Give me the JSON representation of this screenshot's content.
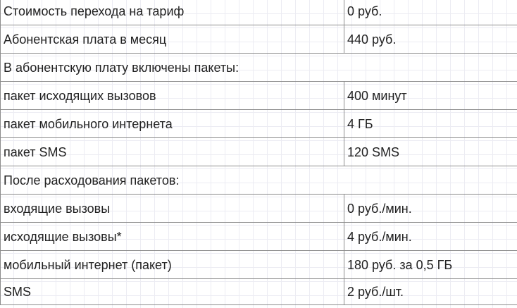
{
  "tariff_table": {
    "rows": [
      {
        "type": "pair",
        "label": "Стоимость перехода на тариф",
        "value": "0 руб."
      },
      {
        "type": "pair",
        "label": "Абонентская плата в месяц",
        "value": "440 руб."
      },
      {
        "type": "section",
        "label": "В абонентскую плату включены пакеты:"
      },
      {
        "type": "pair",
        "label": "пакет исходящих вызовов",
        "value": "400 минут"
      },
      {
        "type": "pair",
        "label": "пакет мобильного интернета",
        "value": "4 ГБ"
      },
      {
        "type": "pair",
        "label": "пакет SMS",
        "value": "120 SMS"
      },
      {
        "type": "section",
        "label": "После расходования пакетов:"
      },
      {
        "type": "pair",
        "label": "входящие вызовы",
        "value": "0 руб./мин."
      },
      {
        "type": "pair",
        "label": "исходящие вызовы*",
        "value": "4 руб./мин."
      },
      {
        "type": "pair",
        "label": "мобильный интернет (пакет)",
        "value": "180 руб. за 0,5 ГБ"
      },
      {
        "type": "pair",
        "label": "SMS",
        "value": "2 руб./шт."
      }
    ]
  }
}
